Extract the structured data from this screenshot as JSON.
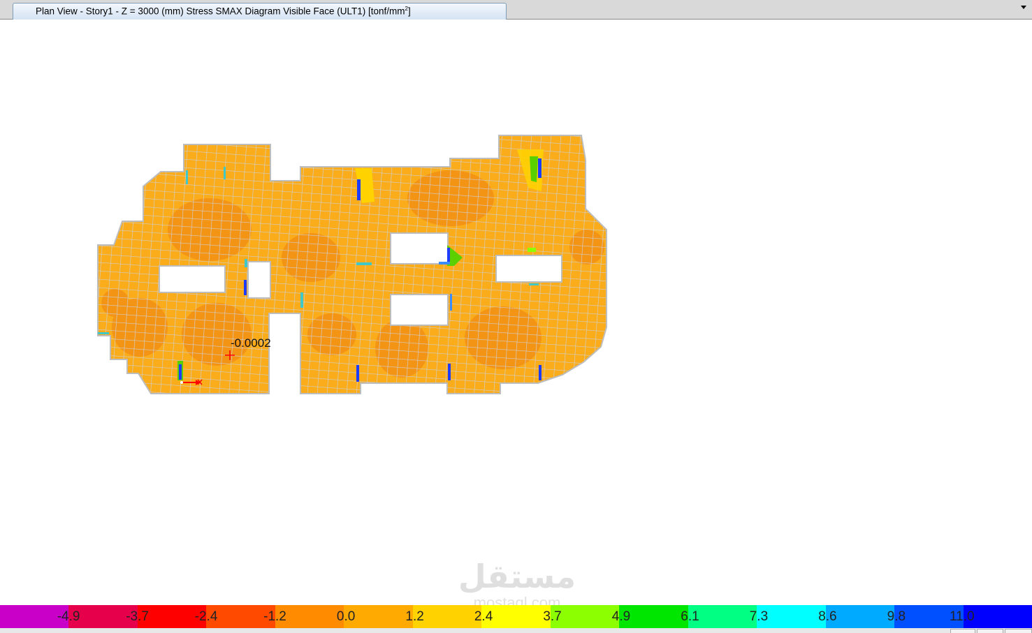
{
  "window": {
    "tab_title": "Plan View - Story1 - Z = 3000 (mm)    Stress SMAX Diagram  Visible Face    (ULT1)  [tonf/mm",
    "tab_title_sup": "2",
    "tab_title_end": "]"
  },
  "icons": {
    "dropdown": "chevron-down-icon",
    "point": "cross-marker-icon",
    "axes": "axis-origin-icon"
  },
  "plot": {
    "point_value": "-0.0002",
    "colors": {
      "base": "#fbac1a",
      "dark": "#f49415",
      "mesh": "#c8c8c8",
      "outline": "#bdbdbd",
      "axis_red": "#ff0000"
    }
  },
  "legend": {
    "segments": [
      {
        "color": "#c800c8",
        "label": "-4.9"
      },
      {
        "color": "#e6004c",
        "label": "-3.7"
      },
      {
        "color": "#ff0000",
        "label": "-2.4"
      },
      {
        "color": "#ff4a00",
        "label": "-1.2"
      },
      {
        "color": "#ff8c00",
        "label": "0.0"
      },
      {
        "color": "#ffaa00",
        "label": "1.2"
      },
      {
        "color": "#ffd200",
        "label": "2.4"
      },
      {
        "color": "#ffff00",
        "label": "3.7"
      },
      {
        "color": "#8cff00",
        "label": "4.9"
      },
      {
        "color": "#00e600",
        "label": "6.1"
      },
      {
        "color": "#00ff82",
        "label": "7.3"
      },
      {
        "color": "#00ffff",
        "label": "8.6"
      },
      {
        "color": "#00aaff",
        "label": "9.8"
      },
      {
        "color": "#0050ff",
        "label": "11.0"
      },
      {
        "color": "#0000ff",
        "label": ""
      }
    ]
  },
  "watermark": {
    "logo": "مستقل",
    "domain": "mostaql.com"
  }
}
